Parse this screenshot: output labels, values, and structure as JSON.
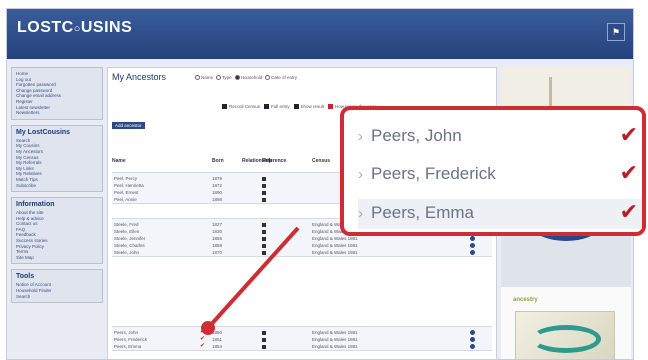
{
  "header": {
    "logo_main": "LOSTC",
    "logo_rest": "USINS",
    "flag_icon": "flag-icon"
  },
  "sidebar": {
    "section1_items": [
      "Home",
      "Log out",
      "Forgotten password",
      "Change password",
      "Change email address",
      "Register",
      "Latest newsletter",
      "Newsletters"
    ],
    "section2_title": "My LostCousins",
    "section2_items": [
      "Search",
      "My Cousins",
      "My Ancestors",
      "My Census",
      "My Referrals",
      "My Links",
      "My Relatives",
      "Match Tips",
      "Subscribe"
    ],
    "section3_title": "Information",
    "section3_items": [
      "About the site",
      "Help & advice",
      "Contact us",
      "FAQ",
      "Feedback",
      "Success stories",
      "Privacy Policy",
      "Terms",
      "Site Map"
    ],
    "section4_title": "Tools",
    "section4_items": [
      "Notice of Account",
      "Household Finder",
      "Search"
    ]
  },
  "main": {
    "tab_label": "My Ancestors",
    "radio_options": [
      "Name",
      "Type",
      "Household",
      "Date of entry"
    ],
    "check_options": [
      "Record Census",
      "Full entry",
      "Show result",
      "How to use this page"
    ],
    "notice_button": "Add ancestor",
    "columns": [
      "Name",
      "Born",
      "Relationship",
      "Reference",
      "Census"
    ],
    "group1": [
      {
        "name": "Peel, Percy",
        "born": "1878"
      },
      {
        "name": "Peel, Henrietta",
        "born": "1872"
      },
      {
        "name": "Peel, Ernest",
        "born": "1890"
      },
      {
        "name": "Peel, Annie",
        "born": "1898"
      }
    ],
    "group2": [
      {
        "name": "Steele, Fred",
        "born": "1827",
        "census": "England & Wales 1881"
      },
      {
        "name": "Steele, Ellen",
        "born": "1830",
        "census": "England & Wales 1881"
      },
      {
        "name": "Steele, Jennifer",
        "born": "1855",
        "census": "England & Wales 1881"
      },
      {
        "name": "Steele, Charles",
        "born": "1858",
        "census": "England & Wales 1881"
      },
      {
        "name": "Steele, John",
        "born": "1870",
        "census": "England & Wales 1881"
      }
    ],
    "group3": [
      {
        "name": "Peers, John",
        "born": "1850",
        "census": "England & Wales 1881"
      },
      {
        "name": "Peers, Frederick",
        "born": "1851",
        "census": "England & Wales 1881"
      },
      {
        "name": "Peers, Emma",
        "born": "1854",
        "census": "England & Wales 1881"
      }
    ]
  },
  "ads": {
    "brand": "ancestry"
  },
  "callout": {
    "rows": [
      "Peers, John",
      "Peers, Frederick",
      "Peers, Emma"
    ],
    "chevron": "›",
    "check": "✔"
  }
}
